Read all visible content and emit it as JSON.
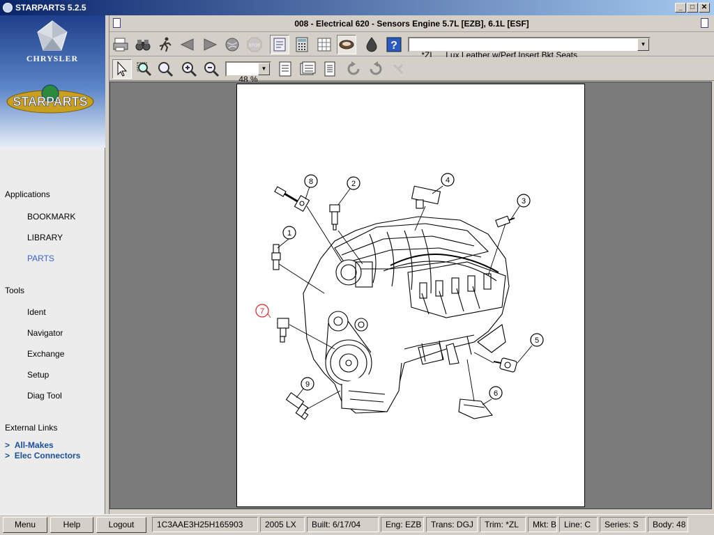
{
  "window": {
    "title": "STARPARTS 5.2.5",
    "controls": {
      "minimize": "_",
      "maximize": "□",
      "close": "✕"
    }
  },
  "sidebar": {
    "brand": "CHRYSLER",
    "product_logo": "STARPARTS",
    "sections": [
      {
        "title": "Applications",
        "items": [
          {
            "label": "BOOKMARK",
            "active": false
          },
          {
            "label": "LIBRARY",
            "active": false
          },
          {
            "label": "PARTS",
            "active": true
          }
        ]
      },
      {
        "title": "Tools",
        "items": [
          {
            "label": "Ident"
          },
          {
            "label": "Navigator"
          },
          {
            "label": "Exchange"
          },
          {
            "label": "Setup"
          },
          {
            "label": "Diag Tool"
          }
        ]
      },
      {
        "title": "External Links",
        "items": [
          {
            "label": "All-Makes"
          },
          {
            "label": "Elec Connectors"
          }
        ]
      }
    ],
    "link_prefix": ">"
  },
  "document": {
    "title": "008 - Electrical   620 - Sensors Engine 5.7L [EZB], 6.1L [ESF]"
  },
  "toolbar": {
    "buttons": [
      "print-icon",
      "binoculars-icon",
      "run-icon",
      "back-icon",
      "forward-icon",
      "globe-icon",
      "stop-icon",
      "notes-icon",
      "calculator-icon",
      "grid-icon",
      "filter-icon",
      "fluid-drop-icon",
      "help-icon"
    ],
    "stop_label": "STOP",
    "help_label": "?",
    "trim_select": "*ZL     Lux Leather w/Perf Insert Bkt Seats"
  },
  "viewer_toolbar": {
    "buttons": [
      "pointer-icon",
      "zoom-box-icon",
      "magnifier-icon",
      "zoom-in-icon",
      "zoom-out-icon",
      "page-fit-icon",
      "page-width-icon",
      "page-icon",
      "rotate-left-icon",
      "rotate-right-icon",
      "rotate-reset-icon"
    ],
    "zoom": "48 %"
  },
  "diagram": {
    "callouts": [
      {
        "num": "1",
        "highlighted": false
      },
      {
        "num": "2",
        "highlighted": false
      },
      {
        "num": "3",
        "highlighted": false
      },
      {
        "num": "4",
        "highlighted": false
      },
      {
        "num": "5",
        "highlighted": false
      },
      {
        "num": "6",
        "highlighted": false
      },
      {
        "num": "7",
        "highlighted": true
      },
      {
        "num": "8",
        "highlighted": false
      },
      {
        "num": "9",
        "highlighted": false
      }
    ],
    "highlight_color": "#d81e1e"
  },
  "statusbar": {
    "menu": "Menu",
    "help": "Help",
    "logout": "Logout",
    "vin": "1C3AAE3H25H165903",
    "model": "2005 LX",
    "built": "Built: 6/17/04",
    "eng": "Eng: EZB",
    "trans": "Trans: DGJ",
    "trim": "Trim: *ZL",
    "mkt": "Mkt: B",
    "line": "Line: C",
    "series": "Series: S",
    "body": "Body: 48"
  },
  "colors": {
    "titlebar_start": "#0a246a",
    "titlebar_end": "#a6caf0",
    "active_nav": "#3a5fd0",
    "external_link": "#1a4f9a",
    "viewer_bg": "#7a7a7a"
  }
}
